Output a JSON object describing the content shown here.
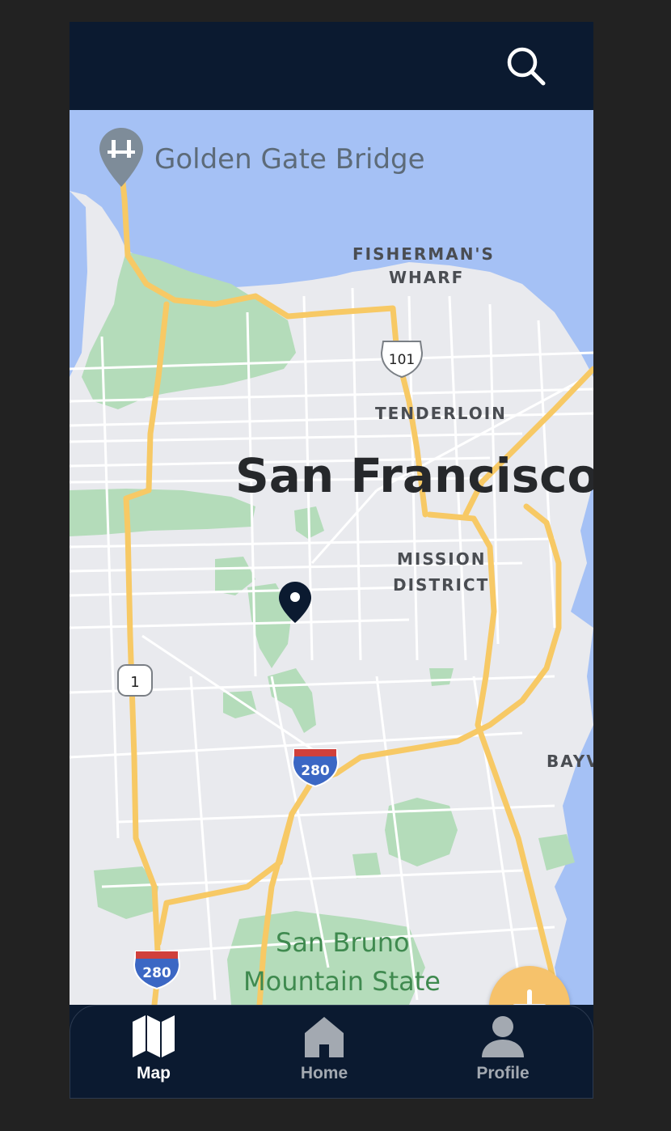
{
  "header": {
    "search_icon": "search-icon"
  },
  "map": {
    "labels": {
      "golden_gate": "Golden Gate Bridge",
      "fishermans_line1": "FISHERMAN'S",
      "fishermans_line2": "WHARF",
      "tenderloin": "TENDERLOIN",
      "city": "San Francisco",
      "mission_line1": "MISSION",
      "mission_line2": "DISTRICT",
      "bayview": "BAYV",
      "park_line1": "San Bruno",
      "park_line2": "Mountain State"
    },
    "shields": {
      "us101": "101",
      "ca1": "1",
      "i280_a": "280",
      "i280_b": "280"
    },
    "colors": {
      "water": "#a5c1f5",
      "land": "#e9eaee",
      "park": "#b4dcba",
      "highway": "#f7c965",
      "marker": "#0b1a30"
    }
  },
  "fab": {
    "icon": "plus-icon",
    "color": "#f6c26b"
  },
  "nav": {
    "items": [
      {
        "label": "Map",
        "icon": "map-icon",
        "active": true
      },
      {
        "label": "Home",
        "icon": "home-icon",
        "active": false
      },
      {
        "label": "Profile",
        "icon": "person-icon",
        "active": false
      }
    ]
  }
}
